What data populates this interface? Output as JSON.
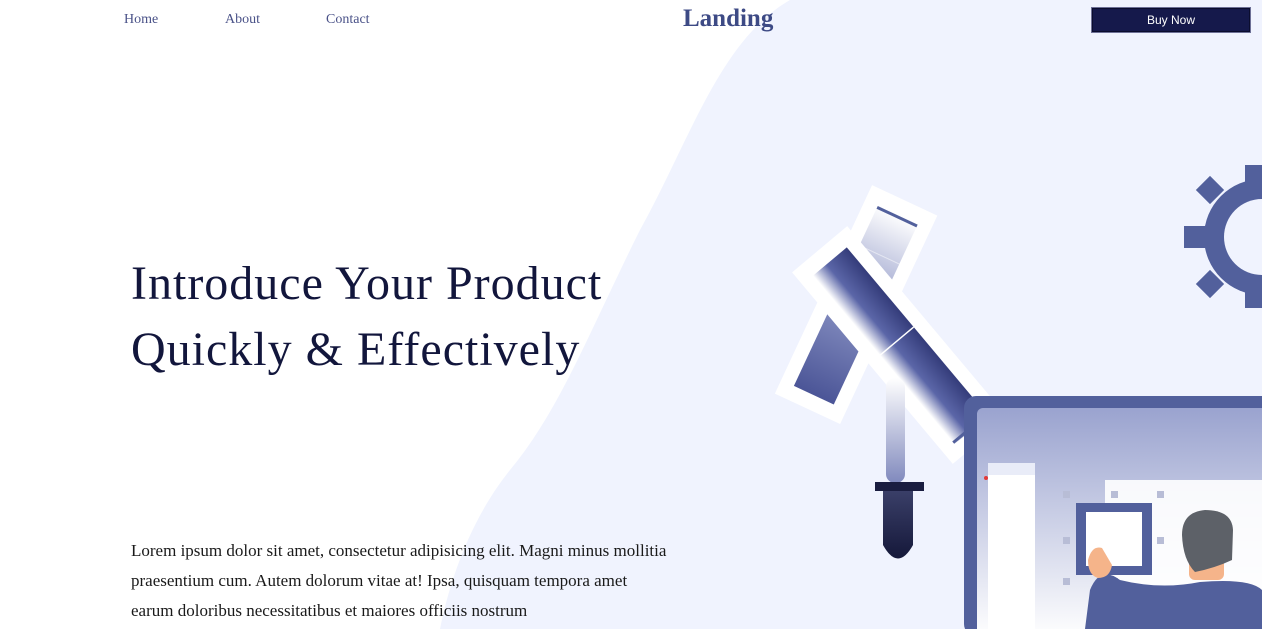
{
  "nav": {
    "items": [
      {
        "label": "Home"
      },
      {
        "label": "About"
      },
      {
        "label": "Contact"
      }
    ]
  },
  "brand": {
    "name": "Landing"
  },
  "cta": {
    "label": "Buy Now"
  },
  "hero": {
    "title_line1": "Introduce Your Product",
    "title_line2": "Quickly & Effectively",
    "body": "Lorem ipsum dolor sit amet, consectetur adipisicing elit. Magni minus mollitia praesentium cum. Autem dolorum vitae at! Ipsa, quisquam tempora amet earum doloribus necessitatibus et maiores officiis nostrum"
  },
  "colors": {
    "accent": "#5260a0",
    "navy": "#15194b",
    "blob": "#f0f3fe"
  },
  "illustration": {
    "icons": [
      "gear-icon",
      "color-swatch-icon",
      "dropper-icon",
      "monitor-icon",
      "person-icon"
    ]
  }
}
